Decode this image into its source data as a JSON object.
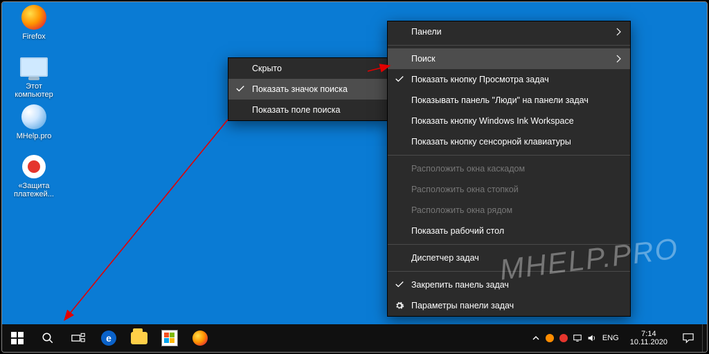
{
  "desktop_icons": [
    {
      "label": "Firefox"
    },
    {
      "label": "Этот\nкомпьютер"
    },
    {
      "label": "MHelp.pro"
    },
    {
      "label": "«Защита\nплатежей..."
    }
  ],
  "submenu": {
    "items": [
      {
        "label": "Скрыто",
        "checked": false
      },
      {
        "label": "Показать значок поиска",
        "checked": true,
        "hover": true
      },
      {
        "label": "Показать поле поиска",
        "checked": false
      }
    ]
  },
  "mainmenu": {
    "groups": [
      [
        {
          "label": "Панели",
          "chevron": true
        },
        {
          "label": "Поиск",
          "chevron": true,
          "hover": true
        },
        {
          "label": "Показать кнопку Просмотра задач",
          "checked": true
        },
        {
          "label": "Показывать панель \"Люди\" на панели задач"
        },
        {
          "label": "Показать кнопку Windows Ink Workspace"
        },
        {
          "label": "Показать кнопку сенсорной клавиатуры"
        }
      ],
      [
        {
          "label": "Расположить окна каскадом",
          "disabled": true
        },
        {
          "label": "Расположить окна стопкой",
          "disabled": true
        },
        {
          "label": "Расположить окна рядом",
          "disabled": true
        },
        {
          "label": "Показать рабочий стол"
        }
      ],
      [
        {
          "label": "Диспетчер задач"
        }
      ],
      [
        {
          "label": "Закрепить панель задач",
          "checked": true
        },
        {
          "label": "Параметры панели задач",
          "gear": true
        }
      ]
    ]
  },
  "tray": {
    "lang": "ENG",
    "time": "7:14",
    "date": "10.11.2020"
  },
  "watermark": "MHELP.PRO"
}
